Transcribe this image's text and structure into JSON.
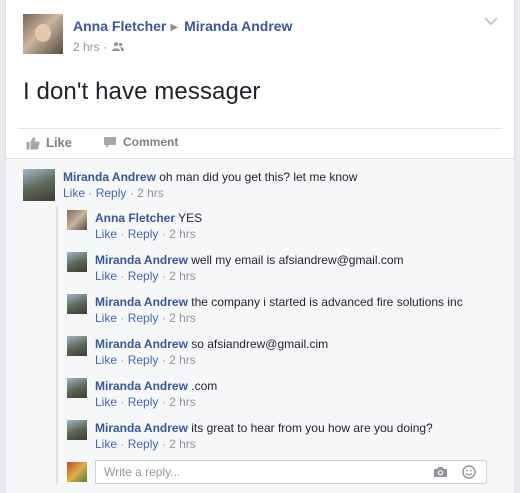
{
  "post": {
    "author": "Anna Fletcher",
    "target": "Miranda Andrew",
    "time": "2 hrs",
    "separator": "·",
    "text": "I don't have messager"
  },
  "actions": {
    "like": "Like",
    "comment": "Comment"
  },
  "comment_meta": {
    "like": "Like",
    "reply": "Reply",
    "dot": "·",
    "time": "2 hrs"
  },
  "comments": [
    {
      "author": "Miranda Andrew",
      "text": "oh man did you get this? let me know"
    },
    {
      "author": "Anna Fletcher",
      "text": "YES"
    },
    {
      "author": "Miranda Andrew",
      "text": "well my email is afsiandrew@gmail.com"
    },
    {
      "author": "Miranda Andrew",
      "text": "the company i started is advanced fire solutions inc"
    },
    {
      "author": "Miranda Andrew",
      "text": "so afsiandrew@gmail.cim"
    },
    {
      "author": "Miranda Andrew",
      "text": ".com"
    },
    {
      "author": "Miranda Andrew",
      "text": "its great to hear from you how are you doing?"
    }
  ],
  "reply_box": {
    "placeholder": "Write a reply..."
  },
  "icons": {
    "audience": "friends-icon",
    "menu": "chevron-down-icon",
    "like": "thumbs-up-icon",
    "comment": "speech-bubble-icon",
    "camera": "camera-icon",
    "emoji": "smiley-icon"
  },
  "colors": {
    "link": "#365899",
    "meta": "#90949c",
    "action": "#7f7f7f",
    "comments_bg": "#f6f7f9"
  }
}
